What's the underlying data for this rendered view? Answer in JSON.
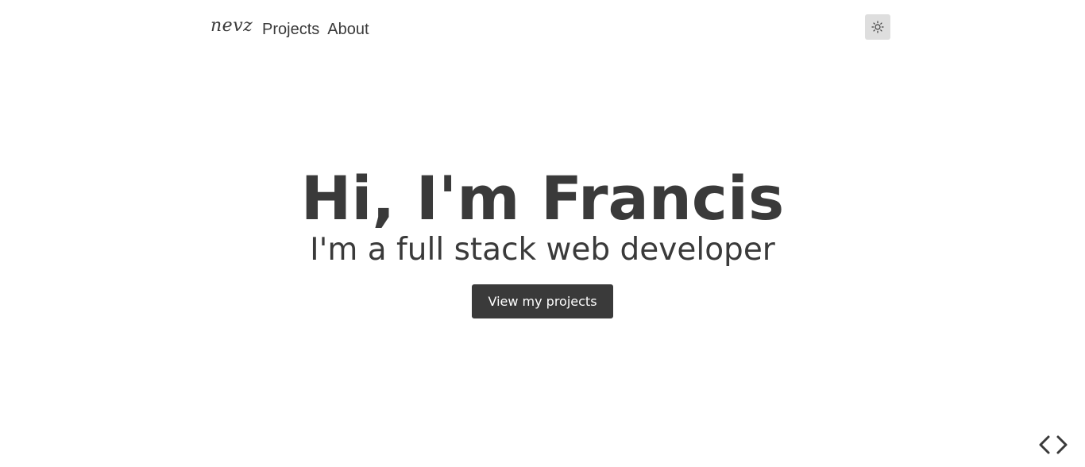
{
  "nav": {
    "brand": "nevz",
    "links": [
      {
        "label": "Projects"
      },
      {
        "label": "About"
      }
    ],
    "theme_icon": "sun-icon"
  },
  "hero": {
    "title": "Hi, I'm Francis",
    "subtitle": "I'm a full stack web developer",
    "cta_label": "View my projects"
  },
  "footer": {
    "icon": "code-icon"
  },
  "colors": {
    "text": "#3a3a3a",
    "background": "#ffffff",
    "toggle_bg": "#dedede",
    "button_bg": "#3a3a3a",
    "button_text": "#ffffff"
  }
}
